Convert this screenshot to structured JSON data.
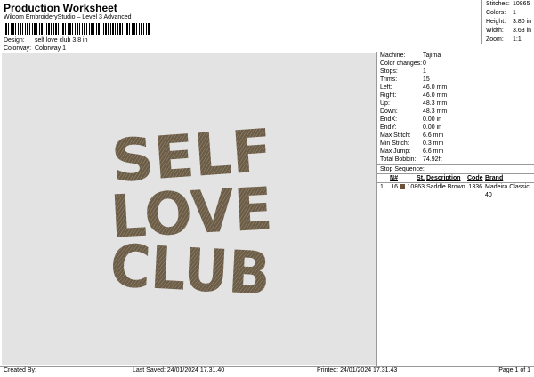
{
  "header": {
    "title": "Production Worksheet",
    "subtitle": "Wilcom EmbroideryStudio – Level 3 Advanced",
    "design_label": "Design:",
    "design_value": "self love club 3.8 in",
    "colorway_label": "Colorway:",
    "colorway_value": "Colorway 1"
  },
  "stats": [
    {
      "k": "Stitches:",
      "v": "10865"
    },
    {
      "k": "Colors:",
      "v": "1"
    },
    {
      "k": "Height:",
      "v": "3.80 in"
    },
    {
      "k": "Width:",
      "v": "3.63 in"
    },
    {
      "k": "Zoom:",
      "v": "1:1"
    }
  ],
  "design": {
    "lines": [
      "SELF",
      "LOVE",
      "CLUB"
    ],
    "thread_color": "#6b5c48"
  },
  "machine": [
    {
      "k": "Machine:",
      "v": "Tajima"
    },
    {
      "k": "Color changes:",
      "v": "0"
    },
    {
      "k": "Stops:",
      "v": "1"
    },
    {
      "k": "Trims:",
      "v": "15"
    },
    {
      "k": "Left:",
      "v": "46.0 mm"
    },
    {
      "k": "Right:",
      "v": "46.0 mm"
    },
    {
      "k": "Up:",
      "v": "48.3 mm"
    },
    {
      "k": "Down:",
      "v": "48.3 mm"
    },
    {
      "k": "EndX:",
      "v": "0.00 in"
    },
    {
      "k": "EndY:",
      "v": "0.00 in"
    },
    {
      "k": "Max Stitch:",
      "v": "6.6 mm"
    },
    {
      "k": "Min Stitch:",
      "v": "0.3 mm"
    },
    {
      "k": "Max Jump:",
      "v": "6.6 mm"
    },
    {
      "k": "Total Bobbin:",
      "v": "74.92ft"
    }
  ],
  "sequence": {
    "title": "Stop Sequence:",
    "columns": [
      "N#",
      "St.",
      "Description",
      "Code",
      "Brand"
    ],
    "rows": [
      {
        "index": "1.",
        "n": "16",
        "color": "#6b5138",
        "st": "10863",
        "description": "Saddle Brown",
        "code": "1336",
        "brand": "Madeira Classic 40"
      }
    ]
  },
  "footer": {
    "created": "Created By:",
    "saved": "Last Saved: 24/01/2024 17.31.40",
    "printed": "Printed: 24/01/2024 17.31.43",
    "page": "Page 1 of 1"
  }
}
